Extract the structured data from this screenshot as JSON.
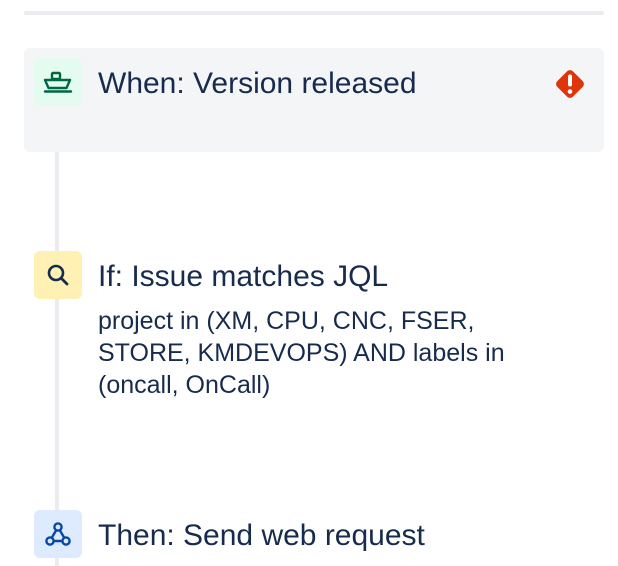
{
  "steps": {
    "trigger": {
      "icon": "ship-icon",
      "title": "When: Version released",
      "status_icon": "error-icon"
    },
    "condition": {
      "icon": "search-icon",
      "title": "If: Issue matches JQL",
      "description": "project in (XM, CPU, CNC, FSER, STORE, KMDEVOPS) AND labels in (oncall, OnCall)"
    },
    "action": {
      "icon": "webhook-icon",
      "title": "Then: Send web request"
    }
  },
  "colors": {
    "trigger_icon_bg": "#e3fcef",
    "trigger_icon_fg": "#006644",
    "condition_icon_bg": "#fff0b3",
    "action_icon_bg": "#deebff",
    "action_icon_fg": "#0747a6",
    "error": "#de350b",
    "text": "#172b4d",
    "card_bg": "#f4f5f7"
  }
}
